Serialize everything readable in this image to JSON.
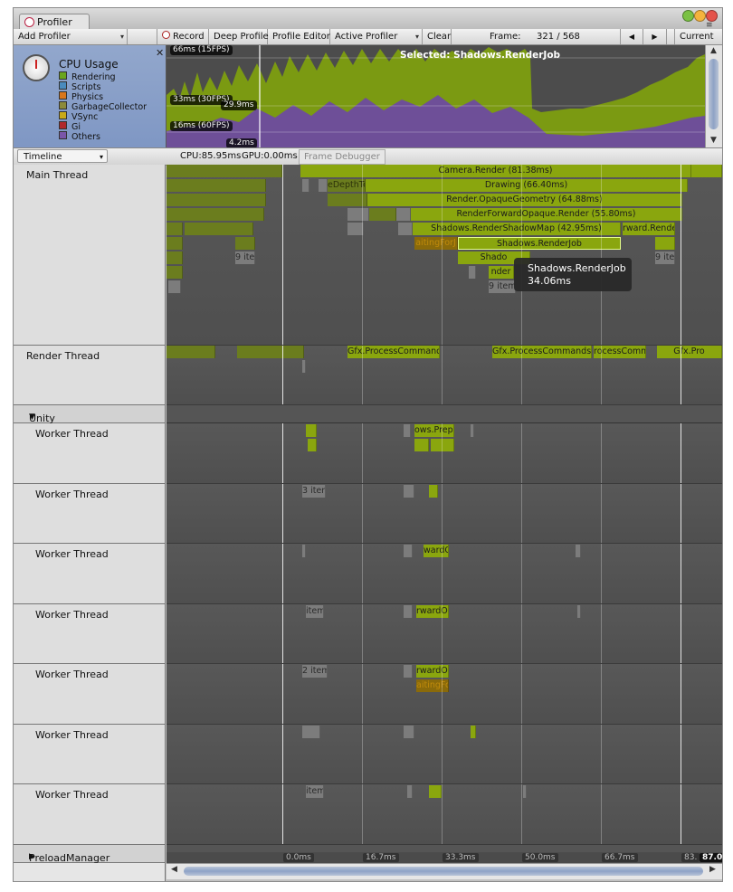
{
  "window": {
    "tab_title": "Profiler"
  },
  "toolbar": {
    "add_profiler": "Add Profiler",
    "record": "Record",
    "deep_profile": "Deep Profile",
    "profile_editor": "Profile Editor",
    "active_profiler": "Active Profiler",
    "clear": "Clear",
    "frame_label": "Frame:",
    "frame_value": "321 / 568",
    "current": "Current",
    "prev_icon": "◀",
    "next_icon": "▶"
  },
  "cpu_usage": {
    "title": "CPU Usage",
    "close": "✕",
    "legend": [
      {
        "label": "Rendering",
        "color": "#6aa51c"
      },
      {
        "label": "Scripts",
        "color": "#4a8bbd"
      },
      {
        "label": "Physics",
        "color": "#d9771c"
      },
      {
        "label": "GarbageCollector",
        "color": "#8c8a3a"
      },
      {
        "label": "VSync",
        "color": "#c9a916"
      },
      {
        "label": "Gi",
        "color": "#b0282c"
      },
      {
        "label": "Others",
        "color": "#7a56a8"
      }
    ],
    "graph_labels": {
      "ms66": "66ms (15FPS)",
      "ms33": "33ms (30FPS)",
      "ms16": "16ms (60FPS)",
      "cursor_value": "29.9ms",
      "bottom_value": "4.2ms",
      "selected": "Selected: Shadows.RenderJob"
    }
  },
  "timeline_header": {
    "view_dropdown": "Timeline",
    "cpu": "CPU:85.95ms",
    "gpu": "GPU:0.00ms",
    "frame_debugger": "Frame Debugger"
  },
  "threads": {
    "main": "Main Thread",
    "render": "Render Thread",
    "job_system": "Unity Job System",
    "worker": "Worker Thread",
    "preload": "PreloadManager"
  },
  "main_bars": {
    "camera_render": "Camera.Render (81.38ms)",
    "drawing": "Drawing (66.40ms)",
    "opaque_geometry": "Render.OpaqueGeometry (64.88ms)",
    "forward_opaque": "RenderForwardOpaque.Render (55.80ms)",
    "shadow_map": "Shadows.RenderShadowMap (42.95ms)",
    "render_job": "Shadows.RenderJob",
    "depth": "eDepthTe",
    "ward_render": "rward.Rende",
    "waiting": "aitingForJ",
    "shado": "Shado",
    "nder": "nder",
    "items9a": "9 item",
    "items9b": "9 item",
    "items9c": "9 item"
  },
  "render_bars": {
    "gfx1": "Gfx.ProcessCommands",
    "gfx2": "Gfx.ProcessCommands",
    "gfx3": "rocessComm",
    "gfx4": "Gfx.Pro"
  },
  "worker_bars": {
    "prepa": "ows.Prepa",
    "items3": "3 item",
    "ward1": "wardOp",
    "item1": "item",
    "ward2": "rwardOp",
    "items2": "2 item",
    "ward3": "rwardOp",
    "waiting2": "aitingFor",
    "item2": "item"
  },
  "tooltip": {
    "name": "Shadows.RenderJob",
    "time": "34.06ms"
  },
  "axis": {
    "t0": "0.0ms",
    "t1": "16.7ms",
    "t2": "33.3ms",
    "t3": "50.0ms",
    "t4": "66.7ms",
    "t5": "83.",
    "t6": "87.0"
  }
}
